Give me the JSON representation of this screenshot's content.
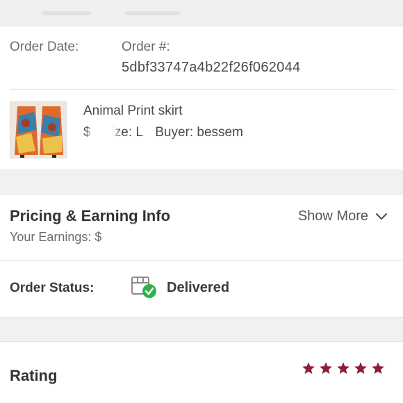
{
  "order": {
    "date_label": "Order Date:",
    "number_label": "Order #:",
    "number_value": "5dbf33747a4b22f26f062044"
  },
  "item": {
    "title": "Animal Print skirt",
    "price_prefix": "$",
    "size": "Size: L",
    "buyer": "Buyer: bessem"
  },
  "pricing": {
    "title": "Pricing & Earning Info",
    "show_more": "Show More",
    "earnings_label": "Your Earnings: $"
  },
  "status": {
    "label": "Order Status:",
    "value": "Delivered",
    "icon": "package-delivered-icon",
    "check_color": "#2bb14a"
  },
  "rating": {
    "label": "Rating",
    "stars": 5,
    "max_stars": 5,
    "star_color": "#8a1f35"
  }
}
